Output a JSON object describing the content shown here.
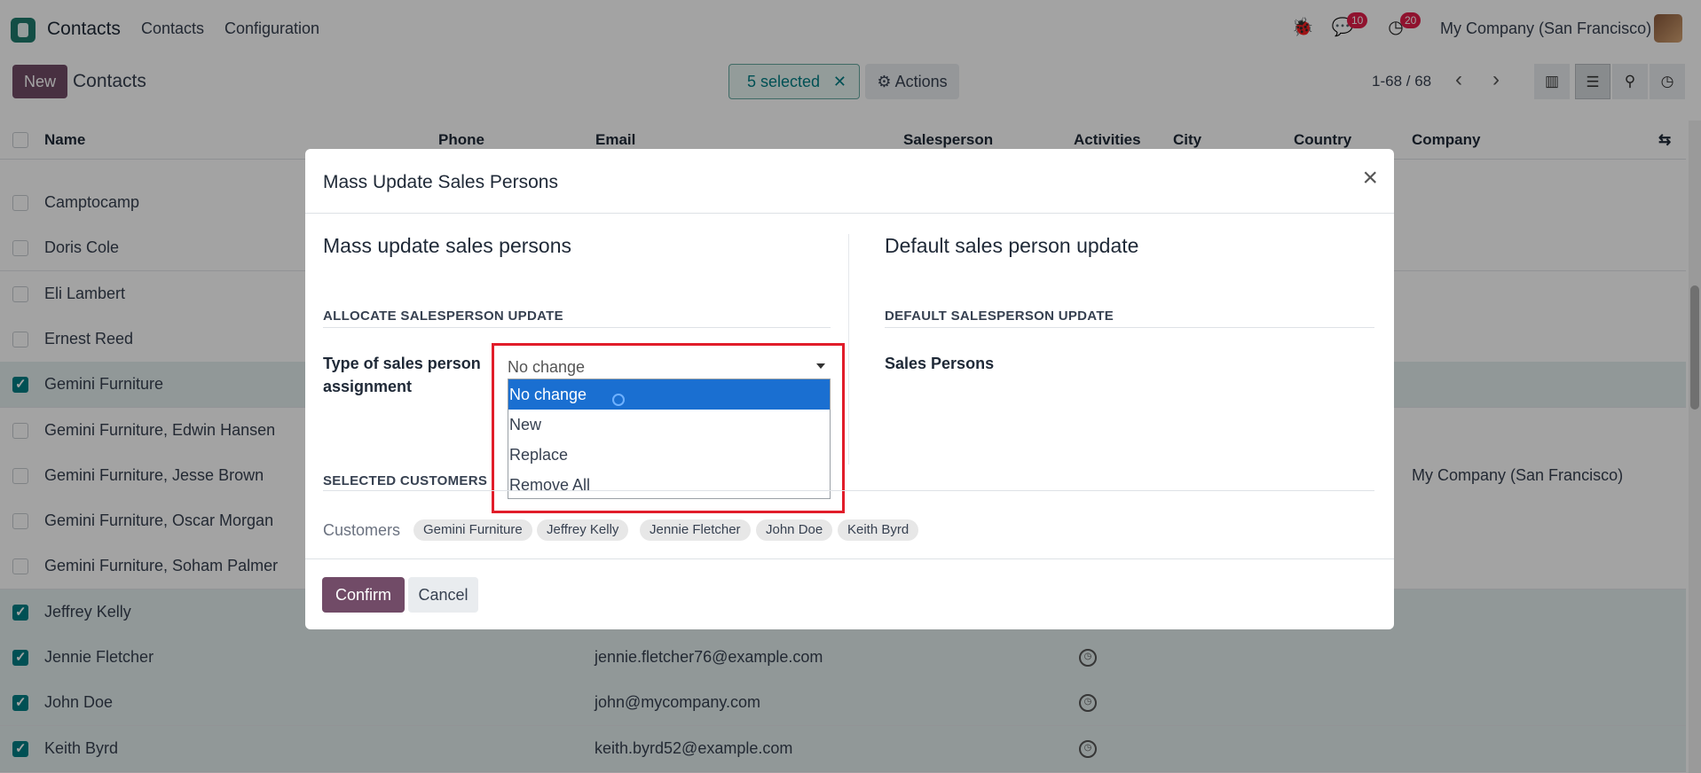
{
  "navbar": {
    "app_name": "Contacts",
    "menu": [
      "Contacts",
      "Configuration"
    ],
    "messages_count": "10",
    "activities_count": "20",
    "company": "My Company (San Francisco)"
  },
  "control_panel": {
    "new_label": "New",
    "breadcrumb": "Contacts",
    "selected_label": "5 selected",
    "actions_label": "Actions",
    "pager": "1-68 / 68"
  },
  "list": {
    "columns": [
      "Name",
      "Phone",
      "Email",
      "Salesperson",
      "Activities",
      "City",
      "Country",
      "Company"
    ],
    "rows": [
      {
        "name": "Camptocamp",
        "email": "",
        "company": "",
        "selected": false
      },
      {
        "name": "Doris Cole",
        "email": "",
        "company": "",
        "selected": false
      },
      {
        "name": "Eli Lambert",
        "email": "",
        "company": "",
        "selected": false
      },
      {
        "name": "Ernest Reed",
        "email": "",
        "company": "",
        "selected": false
      },
      {
        "name": "Gemini Furniture",
        "email": "",
        "company": "",
        "selected": true
      },
      {
        "name": "Gemini Furniture, Edwin Hansen",
        "email": "",
        "company": "",
        "selected": false
      },
      {
        "name": "Gemini Furniture, Jesse Brown",
        "email": "",
        "company": "My Company (San Francisco)",
        "selected": false
      },
      {
        "name": "Gemini Furniture, Oscar Morgan",
        "email": "",
        "company": "",
        "selected": false
      },
      {
        "name": "Gemini Furniture, Soham Palmer",
        "email": "",
        "company": "",
        "selected": false
      },
      {
        "name": "Jeffrey Kelly",
        "email": "",
        "company": "",
        "selected": true
      },
      {
        "name": "Jennie Fletcher",
        "email": "jennie.fletcher76@example.com",
        "company": "",
        "selected": true
      },
      {
        "name": "John Doe",
        "email": "john@mycompany.com",
        "company": "",
        "selected": true
      },
      {
        "name": "Keith Byrd",
        "email": "keith.byrd52@example.com",
        "company": "",
        "selected": true
      }
    ]
  },
  "dialog": {
    "title": "Mass Update Sales Persons",
    "left_title": "Mass update sales persons",
    "left_section": "ALLOCATE SALESPERSON UPDATE",
    "field_label": "Type of sales person assignment",
    "select_value": "No change",
    "options": [
      "No change",
      "New",
      "Replace",
      "Remove All"
    ],
    "right_title": "Default sales person update",
    "right_section": "DEFAULT SALESPERSON UPDATE",
    "right_field_label": "Sales Persons",
    "customers_section": "SELECTED CUSTOMERS",
    "customers_label": "Customers",
    "customers": [
      "Gemini Furniture",
      "Jeffrey Kelly",
      "Jennie Fletcher",
      "John Doe",
      "Keith Byrd"
    ],
    "confirm_label": "Confirm",
    "cancel_label": "Cancel"
  },
  "colors": {
    "brand": "#714b67",
    "teal": "#017e84",
    "highlight": "#1a6fd1",
    "annotation": "#e11d2a"
  }
}
